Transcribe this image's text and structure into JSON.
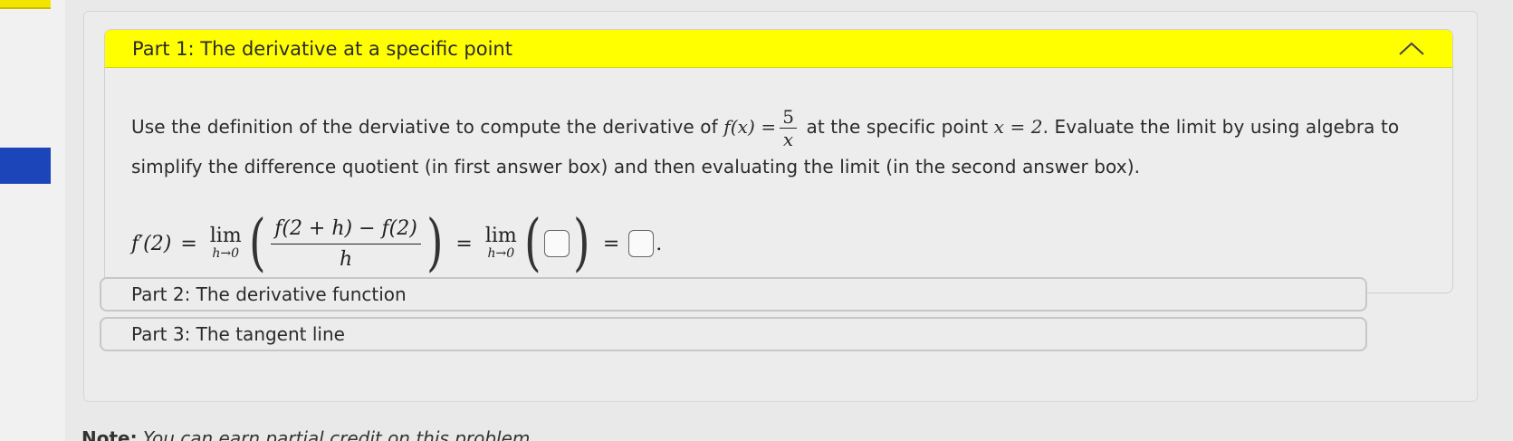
{
  "part1": {
    "title": "Part 1: The derivative at a specific point",
    "text_a": "Use the definition of the derviative to compute the derivative of ",
    "fx": "f(x) =",
    "frac_num": "5",
    "frac_den": "x",
    "text_b": " at the specific point ",
    "point": "x = 2",
    "text_c": ". Evaluate the limit by using algebra to simplify the difference quotient (in first answer box) and then evaluating the limit (in the second answer box).",
    "eq_lhs": "f′(2)",
    "eq_eq": "=",
    "lim_word": "lim",
    "lim_sub": "h→0",
    "dq_num": "f(2 + h) − f(2)",
    "dq_den": "h",
    "answer1_value": "",
    "answer2_value": "",
    "eq_end": "."
  },
  "part2": {
    "title": "Part 2: The derivative function"
  },
  "part3": {
    "title": "Part 3: The tangent line"
  },
  "note": {
    "label": "Note:",
    "text": " You can earn partial credit on this problem."
  },
  "colors": {
    "header_yellow": "#ffff00",
    "sidebar_blue": "#1b45b8"
  },
  "icons": {
    "collapse": "chevron-up-icon"
  }
}
